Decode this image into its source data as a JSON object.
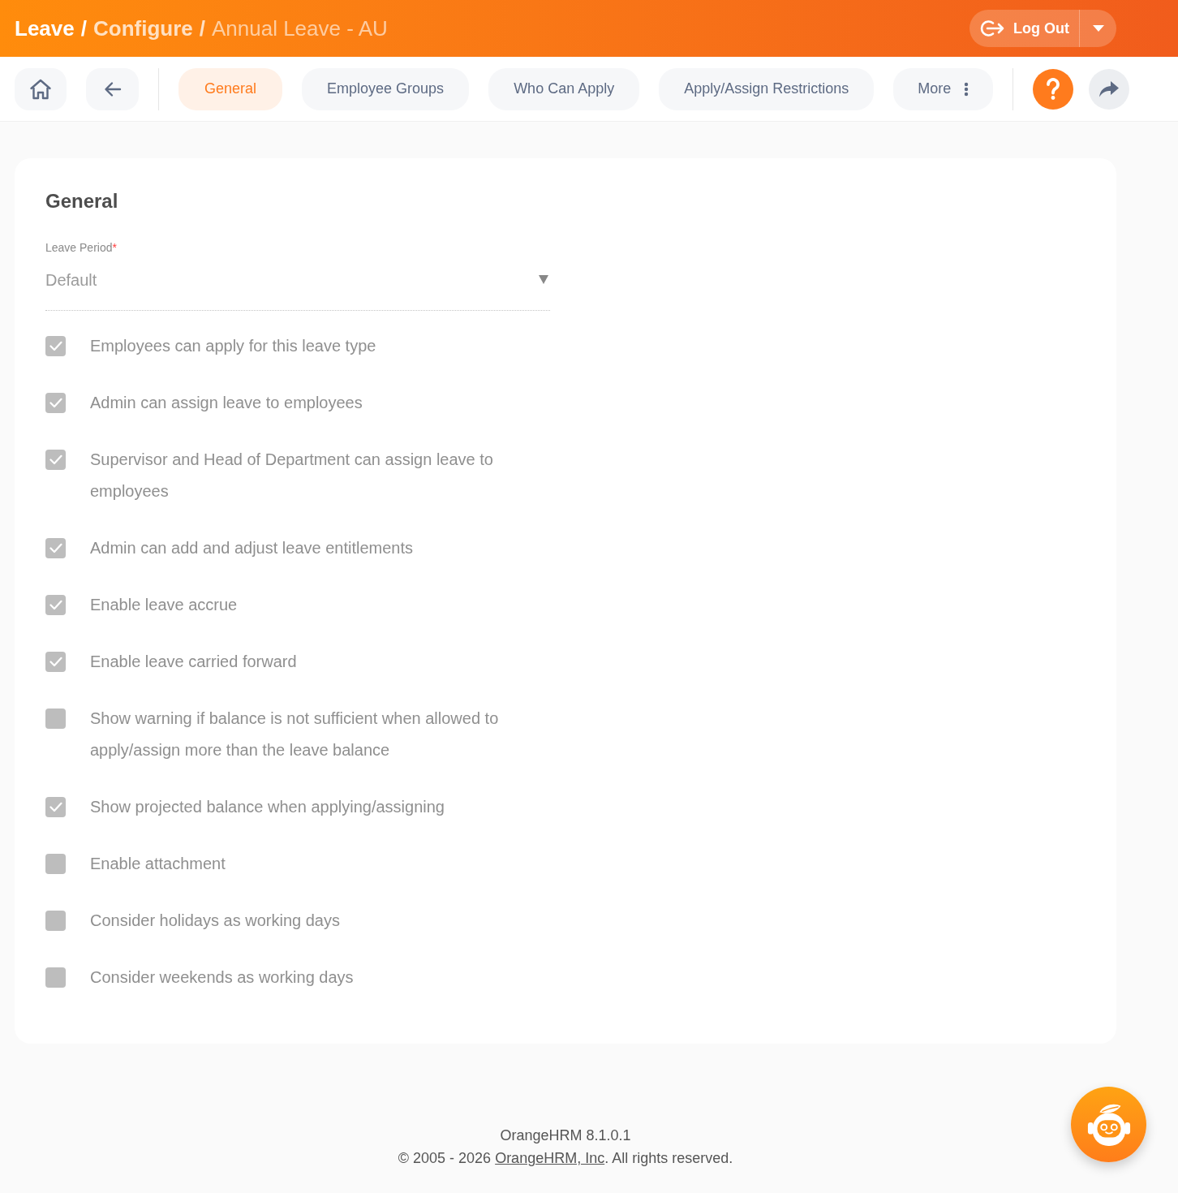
{
  "top_bar": {
    "breadcrumb": [
      {
        "label": "Leave",
        "kind": "module",
        "separator": "/"
      },
      {
        "label": "Configure",
        "kind": "section",
        "separator": "/"
      },
      {
        "label": "Annual Leave - AU",
        "kind": "current"
      }
    ],
    "logout": {
      "label": "Log Out"
    }
  },
  "toolbar": {
    "tabs": [
      {
        "label": "General",
        "selected": true
      },
      {
        "label": "Employee Groups",
        "selected": false
      },
      {
        "label": "Who Can Apply",
        "selected": false
      },
      {
        "label": "Apply/Assign Restrictions",
        "selected": false
      }
    ],
    "more": {
      "label": "More"
    }
  },
  "card": {
    "title": "General",
    "leave_period": {
      "label": "Leave Period",
      "required_mark": "*",
      "value": "Default"
    },
    "options": [
      {
        "label": "Employees can apply for this leave type",
        "checked": true
      },
      {
        "label": "Admin can assign leave to employees",
        "checked": true
      },
      {
        "label": "Supervisor and Head of Department can assign leave to employees",
        "checked": true
      },
      {
        "label": "Admin can add and adjust leave entitlements",
        "checked": true
      },
      {
        "label": "Enable leave accrue",
        "checked": true
      },
      {
        "label": "Enable leave carried forward",
        "checked": true
      },
      {
        "label": "Show warning if balance is not sufficient when allowed to apply/assign more than the leave balance",
        "checked": false
      },
      {
        "label": "Show projected balance when applying/assigning",
        "checked": true
      },
      {
        "label": "Enable attachment",
        "checked": false
      },
      {
        "label": "Consider holidays as working days",
        "checked": false
      },
      {
        "label": "Consider weekends as working days",
        "checked": false
      }
    ]
  },
  "footer": {
    "version": "OrangeHRM 8.1.0.1",
    "copyright_before": "© 2005 - 2026",
    "link": "OrangeHRM, Inc",
    "copyright_after": ". All rights reserved."
  }
}
